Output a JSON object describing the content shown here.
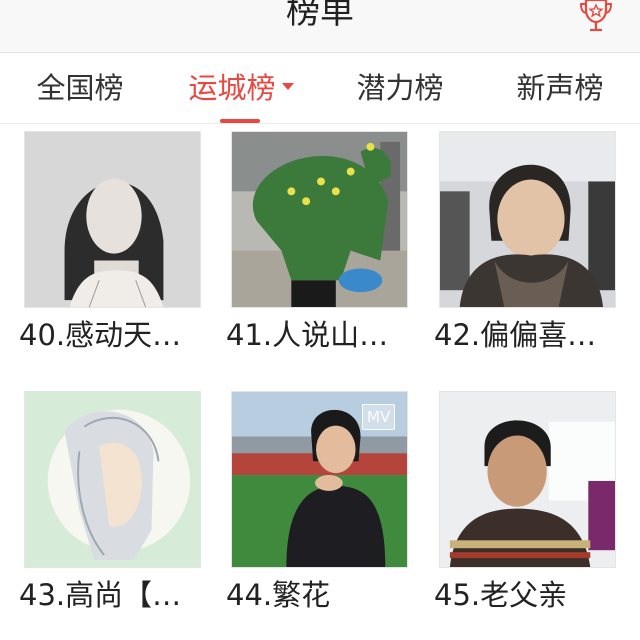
{
  "header": {
    "title": "榜单",
    "trophy_icon": "trophy-icon"
  },
  "tabs": [
    {
      "label": "全国榜",
      "active": false
    },
    {
      "label": "运城榜",
      "active": true
    },
    {
      "label": "潜力榜",
      "active": false
    },
    {
      "label": "新声榜",
      "active": false
    }
  ],
  "accent_color": "#e8483f",
  "items": [
    {
      "rank_title": "40.感动天…"
    },
    {
      "rank_title": "41.人说山…"
    },
    {
      "rank_title": "42.偏偏喜…"
    },
    {
      "rank_title": "43.高尚【…"
    },
    {
      "rank_title": "44.繁花",
      "badge": "MV"
    },
    {
      "rank_title": "45.老父亲"
    }
  ]
}
